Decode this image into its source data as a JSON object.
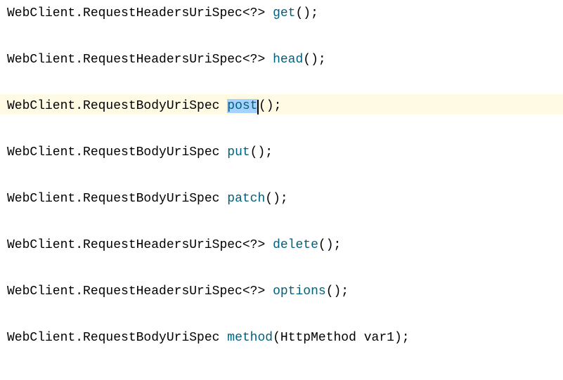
{
  "lines": [
    {
      "type_prefix": "WebClient.RequestHeadersUriSpec",
      "generic": "<?>",
      "method": "get",
      "params": "",
      "highlighted": false,
      "selected": false,
      "has_generic": true
    },
    {
      "type_prefix": "WebClient.RequestHeadersUriSpec",
      "generic": "<?>",
      "method": "head",
      "params": "",
      "highlighted": false,
      "selected": false,
      "has_generic": true
    },
    {
      "type_prefix": "WebClient.RequestBodyUriSpec",
      "generic": "",
      "method": "post",
      "params": "",
      "highlighted": true,
      "selected": true,
      "has_generic": false
    },
    {
      "type_prefix": "WebClient.RequestBodyUriSpec",
      "generic": "",
      "method": "put",
      "params": "",
      "highlighted": false,
      "selected": false,
      "has_generic": false
    },
    {
      "type_prefix": "WebClient.RequestBodyUriSpec",
      "generic": "",
      "method": "patch",
      "params": "",
      "highlighted": false,
      "selected": false,
      "has_generic": false
    },
    {
      "type_prefix": "WebClient.RequestHeadersUriSpec",
      "generic": "<?>",
      "method": "delete",
      "params": "",
      "highlighted": false,
      "selected": false,
      "has_generic": true
    },
    {
      "type_prefix": "WebClient.RequestHeadersUriSpec",
      "generic": "<?>",
      "method": "options",
      "params": "",
      "highlighted": false,
      "selected": false,
      "has_generic": true
    },
    {
      "type_prefix": "WebClient.RequestBodyUriSpec",
      "generic": "",
      "method": "method",
      "params_type": "HttpMethod",
      "params_name": "var1",
      "highlighted": false,
      "selected": false,
      "has_generic": false,
      "has_params": true
    }
  ]
}
